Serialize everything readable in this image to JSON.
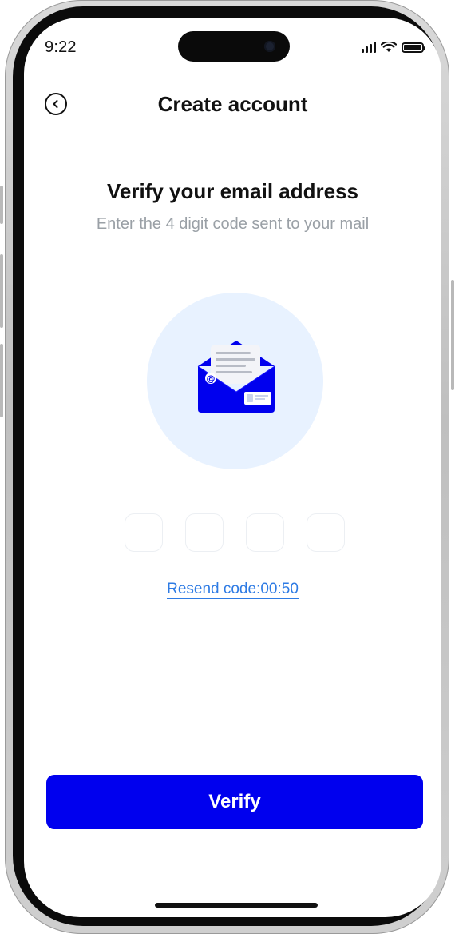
{
  "status_bar": {
    "time": "9:22"
  },
  "header": {
    "title": "Create account"
  },
  "content": {
    "heading": "Verify your email address",
    "subheading": "Enter the 4 digit code sent to your mail",
    "otp_digits": [
      "",
      "",
      "",
      ""
    ],
    "resend_label": "Resend code:00:50"
  },
  "actions": {
    "verify_label": "Verify"
  },
  "colors": {
    "primary": "#0000EE",
    "link": "#2E7BE4",
    "illustration_bg": "#E8F2FF"
  },
  "icons": [
    "back-arrow-icon",
    "cellular-signal-icon",
    "wifi-icon",
    "battery-icon",
    "envelope-illustration"
  ]
}
